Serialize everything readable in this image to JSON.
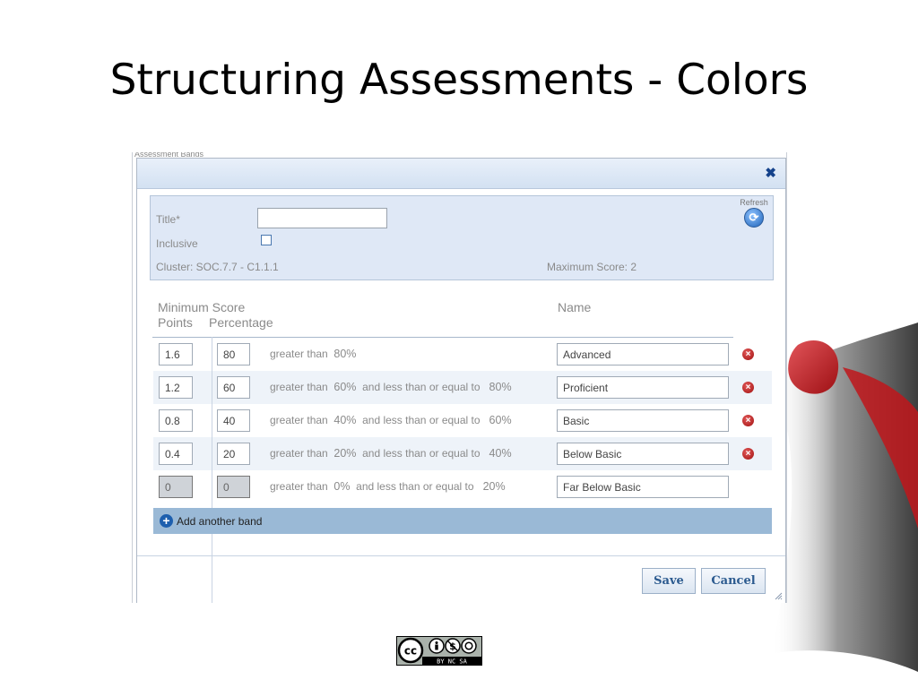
{
  "slide": {
    "title": "Structuring Assessments - Colors"
  },
  "window": {
    "partial_header_text": "Assessment Bands"
  },
  "dialog": {
    "close_icon": "close-icon",
    "refresh_label": "Refresh",
    "form": {
      "title_label": "Title*",
      "title_value": "",
      "inclusive_label": "Inclusive",
      "inclusive_checked": false,
      "cluster_text": "Cluster: SOC.7.7 - C1.1.1",
      "max_score_text": "Maximum Score: 2"
    },
    "headers": {
      "minimum_score": "Minimum Score",
      "points": "Points",
      "percentage": "Percentage",
      "name": "Name"
    },
    "bands": [
      {
        "points": "1.6",
        "percent": "80",
        "gt_text": "greater than",
        "gt_value": "80%",
        "le_text": "",
        "le_value": "",
        "name": "Advanced",
        "deletable": true,
        "disabled": false
      },
      {
        "points": "1.2",
        "percent": "60",
        "gt_text": "greater than",
        "gt_value": "60%",
        "le_text": "and less than or equal to",
        "le_value": "80%",
        "name": "Proficient",
        "deletable": true,
        "disabled": false
      },
      {
        "points": "0.8",
        "percent": "40",
        "gt_text": "greater than",
        "gt_value": "40%",
        "le_text": "and less than or equal to",
        "le_value": "60%",
        "name": "Basic",
        "deletable": true,
        "disabled": false
      },
      {
        "points": "0.4",
        "percent": "20",
        "gt_text": "greater than",
        "gt_value": "20%",
        "le_text": "and less than or equal to",
        "le_value": "40%",
        "name": "Below Basic",
        "deletable": true,
        "disabled": false
      },
      {
        "points": "0",
        "percent": "0",
        "gt_text": "greater than",
        "gt_value": "0%",
        "le_text": "and less than or equal to",
        "le_value": "20%",
        "name": "Far Below Basic",
        "deletable": false,
        "disabled": true
      }
    ],
    "add_band_label": "Add another band",
    "buttons": {
      "save": "Save",
      "cancel": "Cancel"
    }
  },
  "badge": {
    "license_text": "BY NC SA"
  },
  "colors": {
    "accent": "#15428b",
    "header_bg": "#dfe8f6",
    "add_bar": "#9ab9d6",
    "delete": "#c0161b",
    "logo_red": "#c0161b"
  }
}
